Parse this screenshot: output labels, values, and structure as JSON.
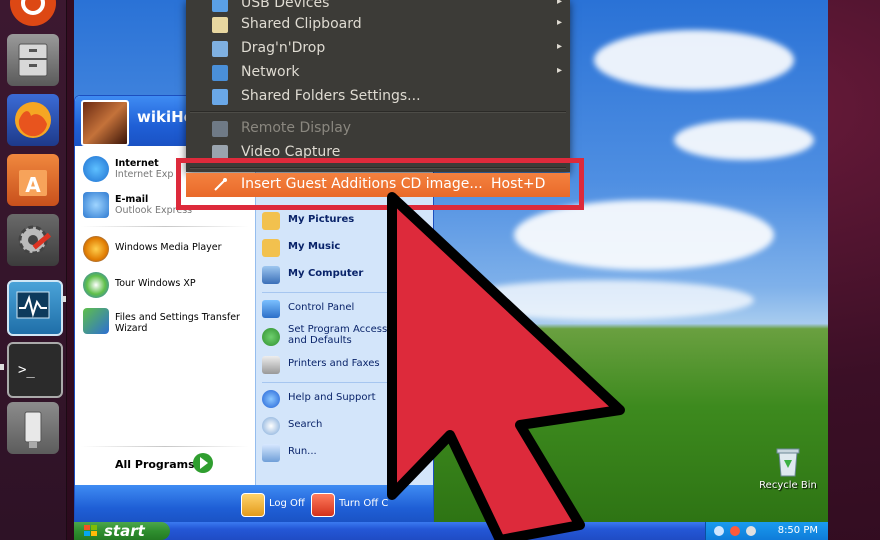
{
  "launcher": {
    "icons": [
      "ubuntu-icon",
      "files-icon",
      "firefox-icon",
      "software-center-icon",
      "system-settings-icon",
      "system-monitor-icon",
      "terminal-icon",
      "usb-drive-icon"
    ]
  },
  "devices_menu": {
    "items": [
      {
        "label": "USB Devices",
        "submenu": true,
        "icon": "usb-icon"
      },
      {
        "label": "Shared Clipboard",
        "submenu": true,
        "icon": "clipboard-icon"
      },
      {
        "label": "Drag'n'Drop",
        "submenu": true,
        "icon": "drag-drop-icon"
      },
      {
        "label": "Network",
        "submenu": true,
        "icon": "network-icon"
      },
      {
        "label": "Shared Folders Settings...",
        "submenu": false,
        "icon": "shared-folder-icon"
      },
      {
        "label": "Remote Display",
        "submenu": false,
        "disabled": true,
        "icon": "remote-display-icon"
      },
      {
        "label": "Video Capture",
        "submenu": false,
        "icon": "video-capture-icon"
      }
    ],
    "highlighted": {
      "label": "Insert Guest Additions CD image...",
      "accelerator": "Host+D",
      "icon": "cd-icon"
    },
    "submenu_arrow": "▸"
  },
  "start_menu": {
    "username": "wikiHo",
    "pinned": [
      {
        "title": "Internet",
        "subtitle": "Internet Exp",
        "icon": "internet-explorer-icon"
      },
      {
        "title": "E-mail",
        "subtitle": "Outlook Express",
        "icon": "outlook-express-icon"
      }
    ],
    "recent": [
      {
        "label": "Windows Media Player",
        "icon": "media-player-icon"
      },
      {
        "label": "Tour Windows XP",
        "icon": "tour-icon"
      },
      {
        "label": "Files and Settings Transfer Wizard",
        "icon": "transfer-wizard-icon"
      }
    ],
    "all_programs": "All Programs",
    "right_items": [
      {
        "label": "My Pictures",
        "bold": true,
        "icon": "my-pictures-icon"
      },
      {
        "label": "My Music",
        "bold": true,
        "icon": "my-music-icon"
      },
      {
        "label": "My Computer",
        "bold": true,
        "icon": "my-computer-icon"
      },
      {
        "label": "Control Panel",
        "bold": false,
        "icon": "control-panel-icon"
      },
      {
        "label": "Set Program Access and Defaults",
        "bold": false,
        "icon": "program-access-icon"
      },
      {
        "label": "Printers and Faxes",
        "bold": false,
        "icon": "printer-icon"
      },
      {
        "label": "Help and Support",
        "bold": false,
        "icon": "help-icon"
      },
      {
        "label": "Search",
        "bold": false,
        "icon": "search-icon"
      },
      {
        "label": "Run...",
        "bold": false,
        "icon": "run-icon"
      }
    ],
    "log_off": "Log Off",
    "turn_off": "Turn Off C"
  },
  "desktop": {
    "recycle_bin": "Recycle Bin"
  },
  "taskbar": {
    "start": "start",
    "clock": "8:50 PM"
  },
  "colors": {
    "menu_bg": "#3c3b37",
    "menu_highlight": "#f07a38",
    "highlight_frame": "#dd2a3b",
    "arrow_fill": "#dd2a3b",
    "xp_blue": "#1f5fd6",
    "xp_green": "#2f8f2f"
  }
}
